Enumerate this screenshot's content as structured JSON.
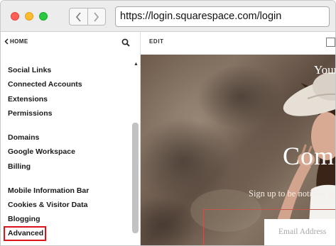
{
  "browser": {
    "url": "https://login.squarespace.com/login",
    "nav_back_icon": "chevron-left-icon",
    "nav_forward_icon": "chevron-right-icon"
  },
  "sidebar": {
    "home_label": "HOME",
    "search_icon": "search-icon",
    "items": [
      {
        "label": "Social Links"
      },
      {
        "label": "Connected Accounts"
      },
      {
        "label": "Extensions"
      },
      {
        "label": "Permissions"
      },
      {
        "label": "Domains"
      },
      {
        "label": "Google Workspace"
      },
      {
        "label": "Billing"
      },
      {
        "label": "Mobile Information Bar"
      },
      {
        "label": "Cookies & Visitor Data"
      },
      {
        "label": "Blogging"
      },
      {
        "label": "Advanced",
        "highlighted": true
      }
    ],
    "highlight_color": "#d9141b"
  },
  "preview": {
    "edit_label": "EDIT",
    "heading_top": "Your",
    "heading_main": "Comi",
    "subtext": "Sign up to be notified w",
    "email_placeholder": "Email Address"
  }
}
